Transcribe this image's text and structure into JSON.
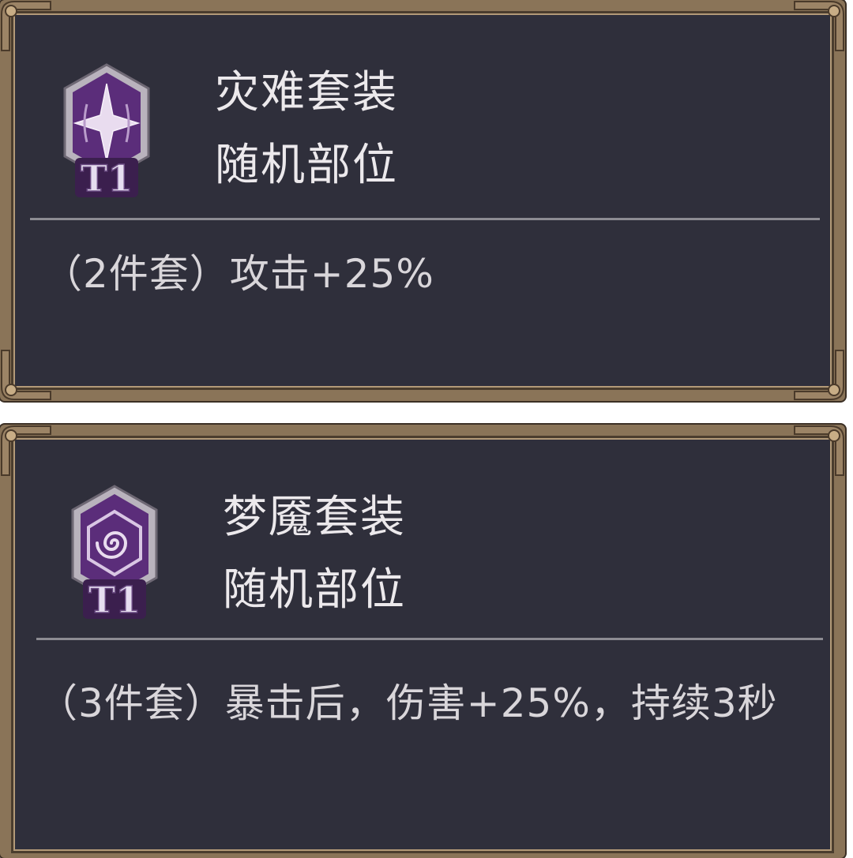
{
  "sets": [
    {
      "tier": "T1",
      "emblem_icon": "four-point-star-icon",
      "name": "灾难套装",
      "slot": "随机部位",
      "bonus": "（2件套）攻击+25%"
    },
    {
      "tier": "T1",
      "emblem_icon": "spiral-hexagon-icon",
      "name": "梦魇套装",
      "slot": "随机部位",
      "bonus": "（3件套）暴击后，伤害+25%，持续3秒"
    }
  ],
  "colors": {
    "panel_bg": "#2f2f3b",
    "frame": "#8a7458",
    "text": "#ece9ec",
    "badge_purple": "#5b2d7a",
    "badge_silver": "#c9c3cc"
  }
}
